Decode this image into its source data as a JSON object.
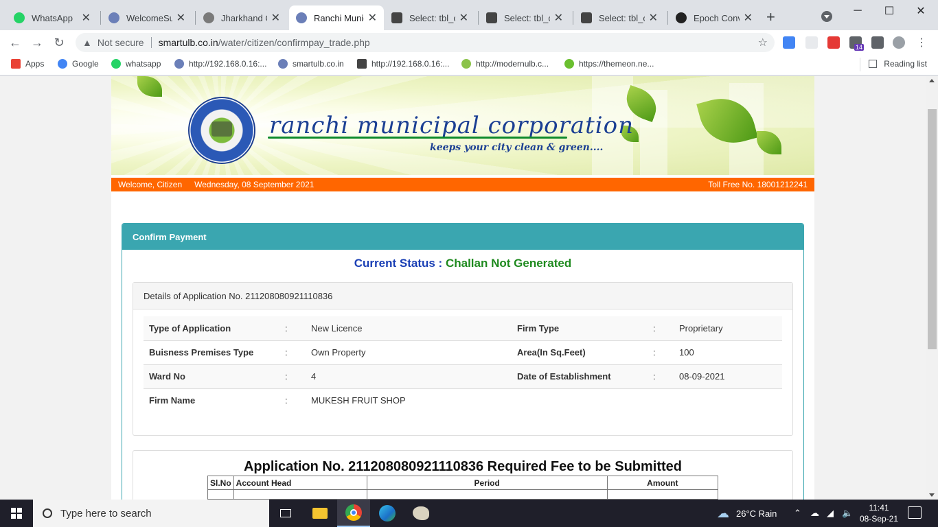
{
  "browser": {
    "tabs": [
      {
        "title": "WhatsApp",
        "color": "#25d366"
      },
      {
        "title": "WelcomeSupe",
        "color": "#6b7fb8"
      },
      {
        "title": "Jharkhand Go",
        "color": "#7a7a7a"
      },
      {
        "title": "Ranchi Munic",
        "color": "#6b7fb8"
      },
      {
        "title": "Select: tbl_co",
        "color": "#444"
      },
      {
        "title": "Select: tbl_co",
        "color": "#444"
      },
      {
        "title": "Select: tbl_co",
        "color": "#444"
      },
      {
        "title": "Epoch Conve",
        "color": "#222"
      }
    ],
    "active_tab_index": 3,
    "new_tab_icon": "plus-icon",
    "window_controls": {
      "minimize": "─",
      "maximize": "☐",
      "close": "✕"
    },
    "address": {
      "security_label": "Not secure",
      "host": "smartulb.co.in",
      "path": "/water/citizen/confirmpay_trade.php"
    },
    "bookmarks": [
      {
        "label": "Apps",
        "color": "#e94235"
      },
      {
        "label": "Google",
        "color": "#4285f4"
      },
      {
        "label": "whatsapp",
        "color": "#25d366"
      },
      {
        "label": "http://192.168.0.16:...",
        "color": "#6b7fb8"
      },
      {
        "label": "smartulb.co.in",
        "color": "#6b7fb8"
      },
      {
        "label": "http://192.168.0.16:...",
        "color": "#444"
      },
      {
        "label": "http://modernulb.c...",
        "color": "#8bc34a"
      },
      {
        "label": "https://themeon.ne...",
        "color": "#6abf2f"
      }
    ],
    "reading_list": "Reading list",
    "extension_badge": "14"
  },
  "site": {
    "brand": "ranchi municipal corporation",
    "tagline": "keeps your city clean & green....",
    "welcome": "Welcome, Citizen",
    "date": "Wednesday, 08 September 2021",
    "toll_free": "Toll Free No. 18001212241"
  },
  "panel": {
    "title": "Confirm Payment",
    "status_label": "Current Status :",
    "status_value": "Challan Not Generated",
    "details_title": "Details of Application No. 211208080921110836",
    "rows": [
      {
        "k1": "Type of Application",
        "v1": "New Licence",
        "k2": "Firm Type",
        "v2": "Proprietary"
      },
      {
        "k1": "Buisness Premises Type",
        "v1": "Own Property",
        "k2": "Area(In Sq.Feet)",
        "v2": "100"
      },
      {
        "k1": "Ward No",
        "v1": "4",
        "k2": "Date of Establishment",
        "v2": "08-09-2021"
      },
      {
        "k1": "Firm Name",
        "v1": "MUKESH FRUIT SHOP",
        "k2": "",
        "v2": ""
      }
    ],
    "colon": ":",
    "fee_title": "Application No. 211208080921110836 Required Fee to be Submitted",
    "fee_headers": {
      "slno": "Sl.No",
      "account_head": "Account Head",
      "period": "Period",
      "amount": "Amount"
    }
  },
  "taskbar": {
    "search_placeholder": "Type here to search",
    "weather": "26°C  Rain",
    "time": "11:41",
    "date": "08-Sep-21"
  },
  "colors": {
    "orange": "#ff6600",
    "teal": "#3aa6b0",
    "status_blue": "#1a3fb5",
    "status_green": "#1e8a1e"
  }
}
